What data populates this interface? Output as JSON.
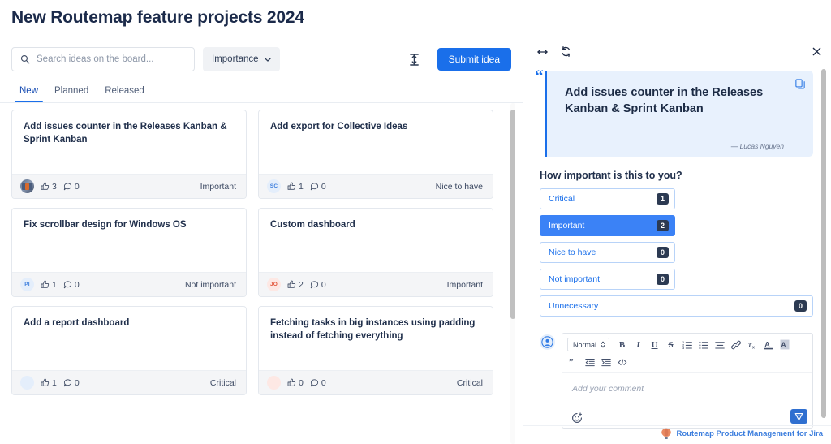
{
  "page": {
    "title": "New Routemap feature projects 2024"
  },
  "toolbar": {
    "search_placeholder": "Search ideas on the board...",
    "search_value": "",
    "search_icon": "search-icon",
    "filter_label": "Importance",
    "filter_chevron_icon": "chevron-down-icon",
    "height_icon": "vertical-resize-icon",
    "submit_label": "Submit idea"
  },
  "tabs": [
    {
      "label": "New",
      "active": true
    },
    {
      "label": "Planned",
      "active": false
    },
    {
      "label": "Released",
      "active": false
    }
  ],
  "cards": [
    {
      "title": "Add issues counter in the Releases Kanban & Sprint Kanban",
      "avatar": {
        "type": "photo",
        "initials": "",
        "bg": "#5a6a85",
        "fg": "#ffffff"
      },
      "likes": "3",
      "comments": "0",
      "importance": "Important"
    },
    {
      "title": "Add export for Collective Ideas",
      "avatar": {
        "type": "initials",
        "initials": "SC",
        "bg": "#e4eefb",
        "fg": "#3b7ddd"
      },
      "likes": "1",
      "comments": "0",
      "importance": "Nice to have"
    },
    {
      "title": "Fix scrollbar design for Windows OS",
      "avatar": {
        "type": "initials",
        "initials": "PI",
        "bg": "#e4eefb",
        "fg": "#3b7ddd"
      },
      "likes": "1",
      "comments": "0",
      "importance": "Not important"
    },
    {
      "title": "Custom dashboard",
      "avatar": {
        "type": "initials",
        "initials": "JO",
        "bg": "#fde8e4",
        "fg": "#e2553a"
      },
      "likes": "2",
      "comments": "0",
      "importance": "Important"
    },
    {
      "title": "Add a report dashboard",
      "avatar": {
        "type": "initials",
        "initials": "",
        "bg": "#e4eefb",
        "fg": "#3b7ddd"
      },
      "likes": "1",
      "comments": "0",
      "importance": "Critical"
    },
    {
      "title": "Fetching tasks in big instances using padding instead of fetching everything",
      "avatar": {
        "type": "initials",
        "initials": "",
        "bg": "#fde8e4",
        "fg": "#e2553a"
      },
      "likes": "0",
      "comments": "0",
      "importance": "Critical"
    }
  ],
  "detail": {
    "header_icons": {
      "expand": "expand-horizontal-icon",
      "refresh": "sync-refresh-icon",
      "close": "close-icon"
    },
    "quote": {
      "mark": "“",
      "text": "Add issues counter in the Releases Kanban & Sprint Kanban",
      "author": "— Lucas Nguyen",
      "copy_icon": "copy-icon"
    },
    "importance_question": "How important is this to you?",
    "importance_options": [
      {
        "label": "Critical",
        "count": "1",
        "selected": false,
        "full": false
      },
      {
        "label": "Important",
        "count": "2",
        "selected": true,
        "full": false
      },
      {
        "label": "Nice to have",
        "count": "0",
        "selected": false,
        "full": false
      },
      {
        "label": "Not important",
        "count": "0",
        "selected": false,
        "full": false
      },
      {
        "label": "Unnecessary",
        "count": "0",
        "selected": false,
        "full": true
      }
    ],
    "comment": {
      "avatar_icon": "user-avatar-icon",
      "format_select_value": "Normal",
      "format_select_icon": "updown-chevron-icon",
      "toolbar_row1": [
        {
          "icon": "bold-icon",
          "glyph": "B"
        },
        {
          "icon": "italic-icon",
          "glyph": "I"
        },
        {
          "icon": "underline-icon",
          "glyph": "U"
        },
        {
          "icon": "strikethrough-icon",
          "glyph": "S"
        },
        {
          "icon": "ordered-list-icon",
          "glyph": ""
        },
        {
          "icon": "bullet-list-icon",
          "glyph": ""
        },
        {
          "icon": "align-icon",
          "glyph": ""
        },
        {
          "icon": "link-icon",
          "glyph": ""
        },
        {
          "icon": "clear-format-icon",
          "glyph": ""
        },
        {
          "icon": "text-color-icon",
          "glyph": "A"
        },
        {
          "icon": "background-color-icon",
          "glyph": "A"
        }
      ],
      "toolbar_row2": [
        {
          "icon": "blockquote-icon",
          "glyph": ""
        },
        {
          "icon": "outdent-icon",
          "glyph": ""
        },
        {
          "icon": "indent-icon",
          "glyph": ""
        },
        {
          "icon": "code-icon",
          "glyph": ""
        }
      ],
      "placeholder": "Add your comment",
      "value": "",
      "emoji_icon": "add-emoji-icon",
      "send_icon": "send-icon"
    }
  },
  "brand": {
    "icon": "hot-air-balloon-icon",
    "text": "Routemap Product Management for Jira"
  },
  "colors": {
    "accent": "#1a6fea",
    "selected_blue": "#3b82f6",
    "quote_bg": "#e8f1fd",
    "title_text": "#1b2a4a",
    "brand_text": "#3b7ddd"
  }
}
